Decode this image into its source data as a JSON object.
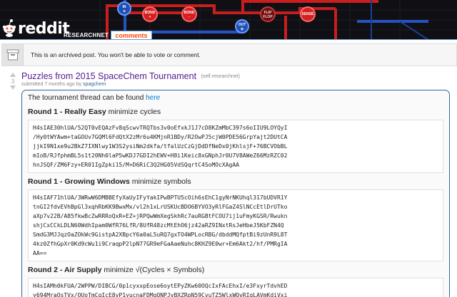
{
  "header": {
    "logo_text": "reddit",
    "subreddit": "RESEARCHNET",
    "tab": "comments",
    "banner_nodes": [
      {
        "label": "BOND\n+",
        "color": "#d42020"
      },
      {
        "label": "BOND\n-",
        "color": "#d42020"
      },
      {
        "label": "FLIP\nFLOP",
        "color": "#6b0f0f"
      },
      {
        "label": "SENSE",
        "color": "#d42020"
      },
      {
        "label": "IN\nα",
        "color": "#1f4fb4"
      },
      {
        "label": "OUT\nψ",
        "color": "#1f4fb4"
      }
    ]
  },
  "archived": {
    "text": "This is an archived post. You won't be able to vote or comment."
  },
  "post": {
    "score": "3",
    "title": "Puzzles from 2015 SpaceChem Tournament",
    "domain": "(self.researchnet)",
    "submitted_prefix": "submitted",
    "age": "7 months ago",
    "by": "by",
    "author": "spagchem",
    "intro_text": "The tournament thread can be found",
    "intro_link": "here"
  },
  "rounds": [
    {
      "prefix": "Round 1 - ",
      "name": "Really Easy",
      "goal": "minimize cycles",
      "code": "H4sIAE30hlUA/52QT0vEQAzFv8qScwvTRQTbs3v0oEfxkJ1J7cD8KZmMbC397s6oIIU9LOYQyI\n/Hy0tWYAwm+taGOUv7GQMl6FdQtX2zMr6u4KMjnR1BDy/R2OwPJ5cjW0PDE56GrpYajt2DUtCA\njjkI9N1xe9u2BkZ7IXNlwy1W3S2ysiNm2dkfa/tfalUzCzGjDdDfNeDx0jKhlsjF+76BCVObBL\nmIoB/RJfphmBL5s1t20Nh0laP5wKDJ7GDI2hEWV+H8i1Keic8xGNphJr0U7V8AWeZ66MzRZC02\nhnJSQF/ZM6Fzy+ER01IgZpki15/M+D6RiC3Q2HG05VdSQqrtC4SoMOcXAgAA"
    },
    {
      "prefix": "Round 1 - ",
      "name": "Growing Windows",
      "goal": "minimize symbols",
      "code": "H4sIAF71hlUA/3WRwW6DMBBEfyXaUyIFyYakIPwBPTU5cOih6sEhC1gyNrNKUhql317bUDVR1Y\ntnGI2fdvEVhBpGl3xqhRbKK9BwxMx/vl2h1xLrUSKUcBDO6BYVO3yRlFGaZ4SlNCcEtlDrUTko\naXp7v22B/A85fkwBcZwRRRoQxR+EZ+jRPQwWmXegSkhRc7auRGBtFCOU7ij1uFmyKGSR/Rwukn\nshjCxCCkLDLN60WdhIpam0WfR76LfR/8UfR48zcMtEhO6jz42aRZ9INxtRsJeHbeJ5KbFZN4Q\nSmdG3MJJqzOaZOkWc9GistpA2XBpcY6a0aL5uRQ7gxTO4WPLocRBG/dbddMQfptBi9zUnR9L8T\n4kz0ZfhGpXr0Kd9cWu1i9CraqpP2lpN77GR9eFGaAaeNuhc8KHZ9E0wr+Em6Akt2/hf/PMRgIA\nAA=="
    },
    {
      "prefix": "Round 2 - ",
      "name": "Air Supply",
      "goal": "minimize √(Cycles × Symbols)",
      "code": "H4sIAMh0kFUA/2WPPW/DIBCG/0p1cyxxpEose6oytEPyZKw60OQcIxFAcEhxI/e3FxyrTdvhED\ny694MraOsTVx/OUoTmCqIcE8vP1yucnaFDMgQNPJvBXZRpN59CvuTZ5WlxWQvRIqLAVmKdiVxi"
    }
  ]
}
